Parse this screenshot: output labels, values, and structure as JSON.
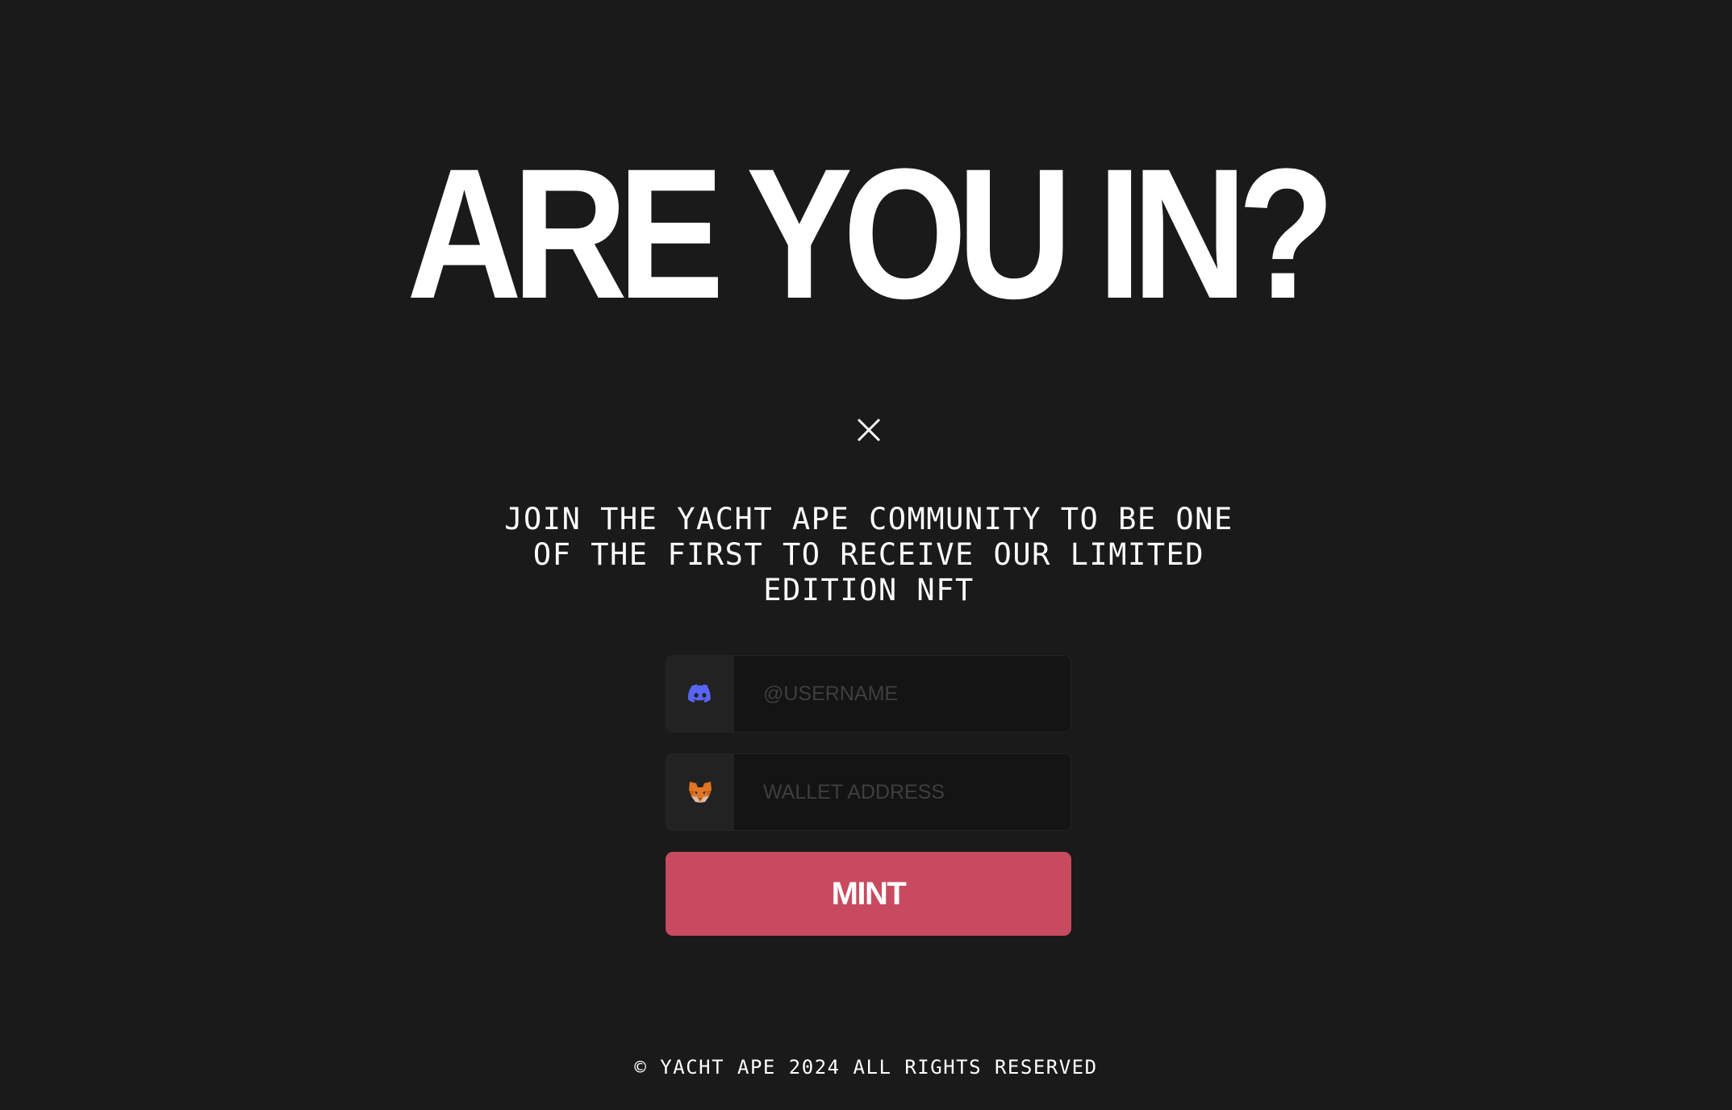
{
  "hero": {
    "headline": "ARE YOU IN?"
  },
  "close": {
    "icon": "close-icon"
  },
  "tagline": "JOIN THE YACHT APE COMMUNITY TO BE ONE OF THE FIRST TO RECEIVE OUR LIMITED EDITION NFT",
  "form": {
    "username": {
      "icon": "discord-icon",
      "placeholder": "@USERNAME",
      "value": ""
    },
    "wallet": {
      "icon": "metamask-fox-icon",
      "placeholder": "WALLET ADDRESS",
      "value": ""
    },
    "submit_label": "MINT"
  },
  "footer": {
    "copyright": "© YACHT APE 2024 ALL RIGHTS RESERVED"
  },
  "colors": {
    "background": "#1a1a1a",
    "accent": "#c84a5f",
    "discord": "#5865f2",
    "input_background": "#141414"
  }
}
